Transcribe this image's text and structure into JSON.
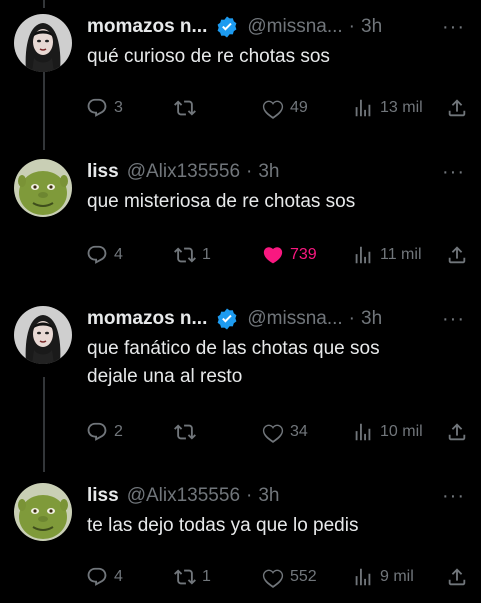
{
  "tweets": [
    {
      "name": "momazos n...",
      "verified": true,
      "handle": "@missna...",
      "time": "3h",
      "text": [
        "qué curioso de re chotas sos"
      ],
      "replies": "3",
      "retweets": "",
      "likes": "49",
      "liked": false,
      "views": "13 mil",
      "avatar": "girl-avatar"
    },
    {
      "name": "liss",
      "verified": false,
      "handle": "@Alix135556",
      "time": "3h",
      "text": [
        "que misteriosa de re chotas sos"
      ],
      "replies": "4",
      "retweets": "1",
      "likes": "739",
      "liked": true,
      "views": "11 mil",
      "avatar": "shrek-avatar"
    },
    {
      "name": "momazos n...",
      "verified": true,
      "handle": "@missna...",
      "time": "3h",
      "text": [
        "que fanático de las chotas que sos",
        "dejale una al resto"
      ],
      "replies": "2",
      "retweets": "",
      "likes": "34",
      "liked": false,
      "views": "10 mil",
      "avatar": "girl-avatar"
    },
    {
      "name": "liss",
      "verified": false,
      "handle": "@Alix135556",
      "time": "3h",
      "text": [
        "te las dejo todas ya que lo pedis"
      ],
      "replies": "4",
      "retweets": "1",
      "likes": "552",
      "liked": false,
      "views": "9 mil",
      "avatar": "shrek-avatar"
    }
  ],
  "more_icon": "more-dots-icon",
  "colors": {
    "bg": "#000000",
    "text": "#e7e9ea",
    "muted": "#71767b",
    "like": "#f91880",
    "verified": "#1d9bf0",
    "line": "#333639"
  }
}
